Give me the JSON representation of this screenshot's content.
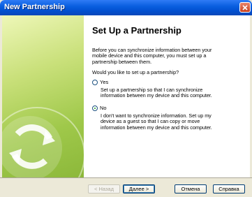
{
  "window": {
    "title": "New Partnership"
  },
  "content": {
    "heading": "Set Up a Partnership",
    "intro": "Before you can synchronize information between your\nmobile device and this computer, you must set up a\npartnership between them.",
    "question": "Would you like to set up a partnership?",
    "options": [
      {
        "label": "Yes",
        "selected": false,
        "description": "Set up a partnership so that I can synchronize\ninformation between my device and this computer."
      },
      {
        "label": "No",
        "selected": true,
        "description": "I don't want to synchronize information. Set up my\ndevice as a guest so that I can copy or move\ninformation between my device and this computer."
      }
    ]
  },
  "buttons": {
    "back": "< Назад",
    "next": "Далее >",
    "cancel": "Отмена",
    "help": "Справка"
  }
}
